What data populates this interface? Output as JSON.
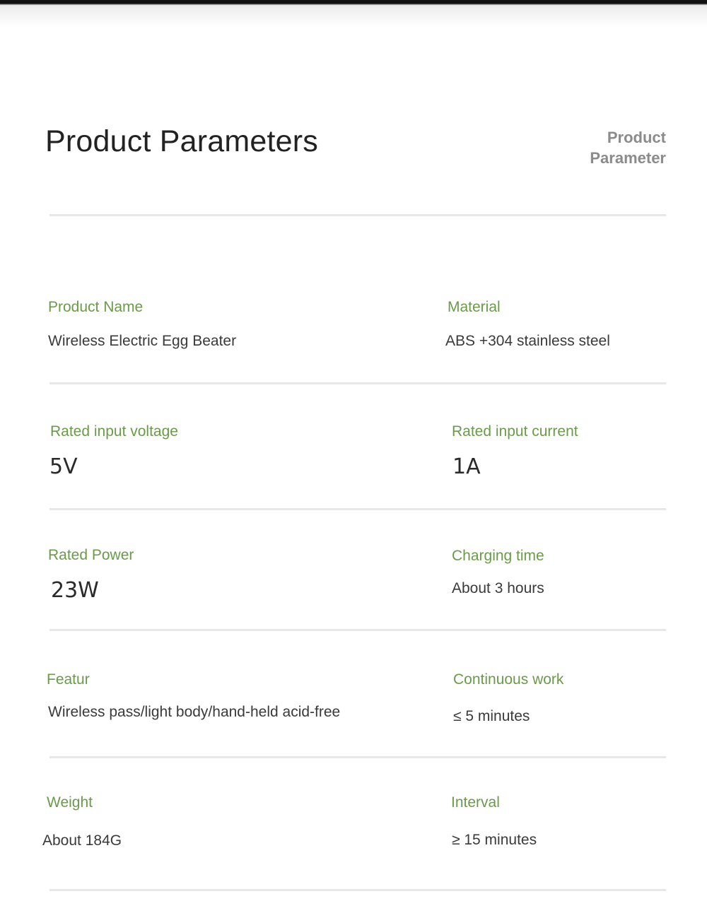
{
  "header": {
    "title": "Product Parameters",
    "subtitle_line1": "Product",
    "subtitle_line2": "Parameter"
  },
  "params": [
    {
      "label": "Product Name",
      "value": "Wireless Electric Egg Beater"
    },
    {
      "label": "Material",
      "value": "ABS +304 stainless steel"
    },
    {
      "label": "Rated input voltage",
      "value": "5V"
    },
    {
      "label": "Rated input current",
      "value": "1A"
    },
    {
      "label": "Rated Power",
      "value": "23W"
    },
    {
      "label": "Charging time",
      "value": "About 3 hours"
    },
    {
      "label": "Featur",
      "value": "Wireless pass/light body/hand-held acid-free"
    },
    {
      "label": "Continuous work",
      "value": "≤ 5 minutes"
    },
    {
      "label": "Weight",
      "value": "About 184G"
    },
    {
      "label": "Interval",
      "value": "≥ 15 minutes"
    }
  ],
  "colors": {
    "label_green": "#6a9a4a",
    "title_text": "#222222",
    "subtitle_gray": "#8b8b8b",
    "divider": "#e7e7e7"
  }
}
